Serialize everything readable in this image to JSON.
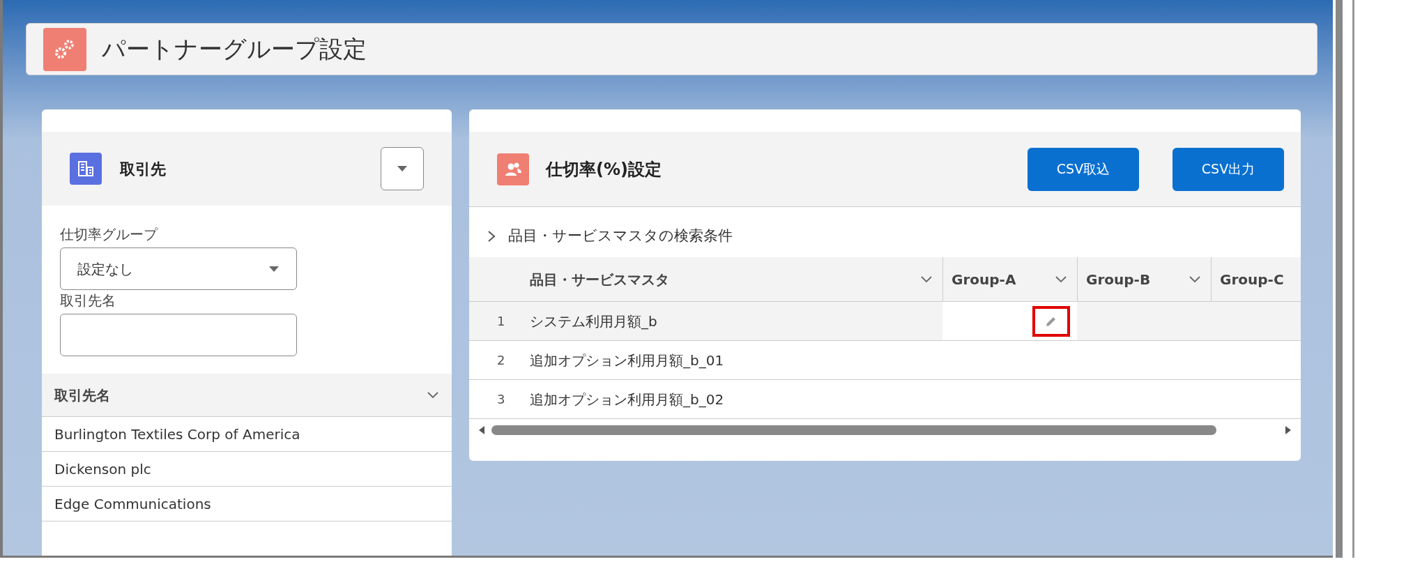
{
  "page": {
    "title": "パートナーグループ設定"
  },
  "account_panel": {
    "title": "取引先",
    "filters": [
      {
        "kind": "select",
        "label": "仕切率グループ",
        "value": "設定なし"
      },
      {
        "kind": "text",
        "label": "取引先名"
      }
    ],
    "list": {
      "column": "取引先名",
      "rows": [
        "Burlington Textiles Corp of America",
        "Dickenson plc",
        "Edge Communications"
      ]
    }
  },
  "rate_panel": {
    "title": "仕切率(%)設定",
    "buttons": [
      "CSV取込",
      "CSV出力"
    ],
    "search_section": {
      "label": "品目・サービスマスタの検索条件",
      "expanded": false
    },
    "table": {
      "columns": [
        "品目・サービスマスタ",
        "Group-A",
        "Group-B",
        "Group-C"
      ],
      "rows": [
        {
          "number": "1",
          "name": "システム利用月額_b",
          "highlighted": true
        },
        {
          "number": "2",
          "name": "追加オプション利用月額_b_01",
          "highlighted": false
        },
        {
          "number": "3",
          "name": "追加オプション利用月額_b_02",
          "highlighted": false
        }
      ]
    }
  }
}
